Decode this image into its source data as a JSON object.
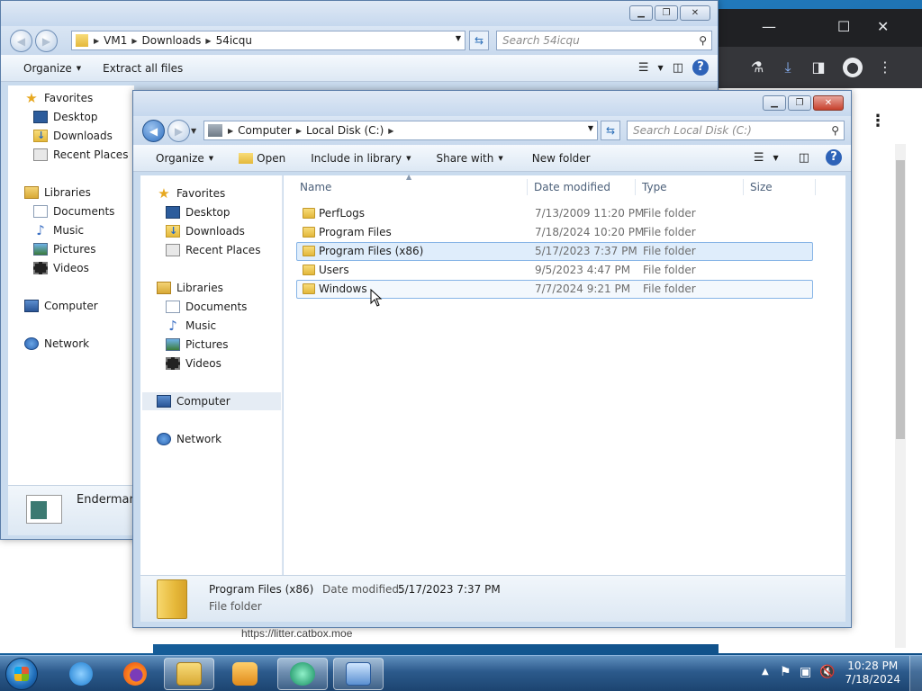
{
  "browser": {
    "bottom_url": "https://litter.catbox.moe"
  },
  "win1": {
    "address": [
      "VM1",
      "Downloads",
      "54icqu"
    ],
    "search_placeholder": "Search 54icqu",
    "toolbar": {
      "organize": "Organize",
      "extract": "Extract all files"
    },
    "nav": [
      "Favorites",
      "Desktop",
      "Downloads",
      "Recent Places",
      "Libraries",
      "Documents",
      "Music",
      "Pictures",
      "Videos",
      "Computer",
      "Network"
    ],
    "status_name": "Endermanc"
  },
  "win2": {
    "address": [
      "Computer",
      "Local Disk (C:)"
    ],
    "search_placeholder": "Search Local Disk (C:)",
    "toolbar": {
      "organize": "Organize",
      "open": "Open",
      "include": "Include in library",
      "share": "Share with",
      "newfolder": "New folder"
    },
    "nav": {
      "favorites": "Favorites",
      "desktop": "Desktop",
      "downloads": "Downloads",
      "recent": "Recent Places",
      "libraries": "Libraries",
      "documents": "Documents",
      "music": "Music",
      "pictures": "Pictures",
      "videos": "Videos",
      "computer": "Computer",
      "network": "Network"
    },
    "columns": {
      "name": "Name",
      "date": "Date modified",
      "type": "Type",
      "size": "Size"
    },
    "files": [
      {
        "name": "PerfLogs",
        "date": "7/13/2009 11:20 PM",
        "type": "File folder"
      },
      {
        "name": "Program Files",
        "date": "7/18/2024 10:20 PM",
        "type": "File folder"
      },
      {
        "name": "Program Files (x86)",
        "date": "5/17/2023 7:37 PM",
        "type": "File folder"
      },
      {
        "name": "Users",
        "date": "9/5/2023 4:47 PM",
        "type": "File folder"
      },
      {
        "name": "Windows",
        "date": "7/7/2024 9:21 PM",
        "type": "File folder"
      }
    ],
    "details": {
      "name": "Program Files (x86)",
      "date_label": "Date modified:",
      "date": "5/17/2023 7:37 PM",
      "type": "File folder"
    }
  },
  "taskbar": {
    "time": "10:28 PM",
    "date": "7/18/2024"
  },
  "colors": {
    "selection": "#dfedfb",
    "taskbar": "#2c5a8c",
    "accent": "#2e63b8"
  }
}
